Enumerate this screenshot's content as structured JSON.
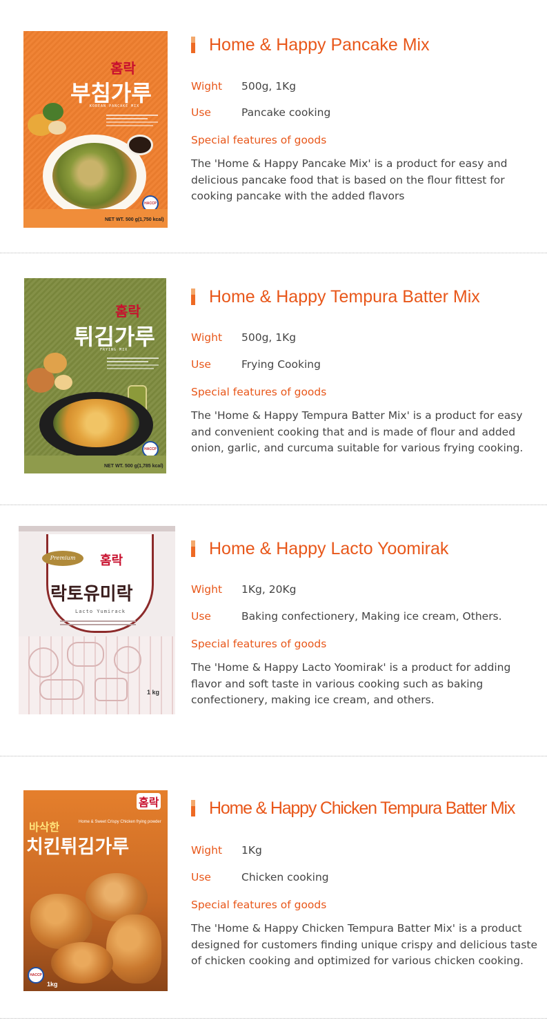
{
  "labels": {
    "weight": "Wight",
    "use": "Use",
    "features": "Special features of goods"
  },
  "products": [
    {
      "title": "Home & Happy Pancake Mix",
      "weight": "500g, 1Kg",
      "use": "Pancake cooking",
      "description": "The 'Home & Happy Pancake Mix' is a product for easy and delicious pancake food that is based on the flour fittest for cooking pancake with the added flavors",
      "package": {
        "brand": "홈락",
        "name": "부침가루",
        "subtitle": "KOREAN PANCAKE MIX",
        "net": "NET WT. 500 g(1,750 kcal)",
        "badge": "HACCP",
        "color": "#ef7f2e"
      }
    },
    {
      "title": "Home & Happy Tempura Batter Mix",
      "weight": "500g, 1Kg",
      "use": "Frying Cooking",
      "description": "The 'Home & Happy Tempura Batter Mix' is a product for easy and convenient cooking that and is made of flour and added onion, garlic, and curcuma suitable for various frying cooking.",
      "package": {
        "brand": "홈락",
        "name": "튀김가루",
        "subtitle": "FRYING MIX",
        "net": "NET WT. 500 g(1,785 kcal)",
        "badge": "HACCP",
        "color": "#7e8b3e"
      }
    },
    {
      "title": "Home & Happy Lacto Yoomirak",
      "weight": "1Kg, 20Kg",
      "use": "Baking confectionery, Making ice cream, Others.",
      "description": "The 'Home & Happy Lacto Yoomirak' is a product for adding flavor and soft taste in various cooking such as baking confectionery, making ice cream, and others.",
      "package": {
        "brand": "홈락",
        "name": "락토유미락",
        "subtitle": "Lacto Yumirack",
        "premium": "Premium",
        "net": "1 kg",
        "color": "#f2ecec"
      }
    },
    {
      "title": "Home & Happy Chicken Tempura Batter Mix",
      "weight": "1Kg",
      "use": "Chicken cooking",
      "description": "The 'Home & Happy Chicken Tempura Batter Mix' is a product designed for customers finding unique crispy and delicious taste of chicken cooking and optimized for various chicken cooking.",
      "package": {
        "brand": "홈락",
        "name": "치킨튀김가루",
        "tagline": "바삭한",
        "subtitle": "Home & Sweet Crispy Chicken frying powder",
        "net": "1kg",
        "badge": "HACCP",
        "color": "#e07a2a"
      }
    }
  ]
}
